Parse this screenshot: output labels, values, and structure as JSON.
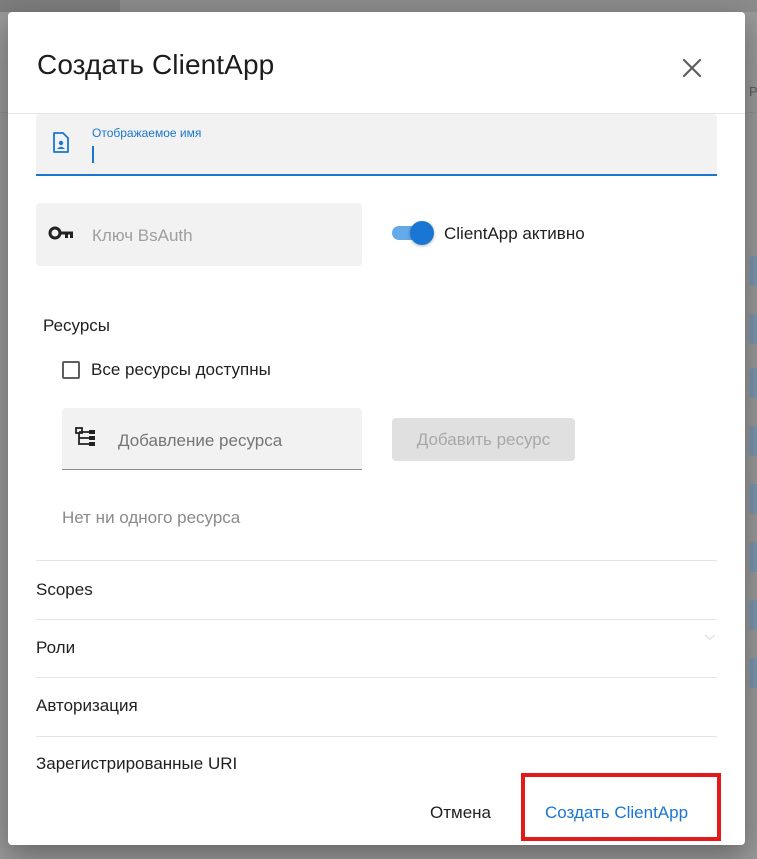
{
  "dialog": {
    "title": "Создать ClientApp",
    "close_icon": "close-icon"
  },
  "fields": {
    "display_name_label": "Отображаемое имя",
    "display_name_value": "",
    "display_name_icon": "contact-card-icon",
    "bsauth_key_placeholder": "Ключ BsAuth",
    "bsauth_key_icon": "key-icon"
  },
  "toggle": {
    "label": "ClientApp активно",
    "checked": true
  },
  "resources": {
    "section_title": "Ресурсы",
    "all_available_label": "Все ресурсы доступны",
    "all_available_checked": false,
    "add_placeholder": "Добавление ресурса",
    "add_icon": "tree-structure-icon",
    "add_button_label": "Добавить ресурс",
    "empty_text": "Нет ни одного ресурса"
  },
  "sections": [
    {
      "title": "Scopes"
    },
    {
      "title": "Роли"
    },
    {
      "title": "Авторизация"
    },
    {
      "title": "Зарегистрированные URI"
    }
  ],
  "actions": {
    "cancel_label": "Отмена",
    "create_label": "Создать ClientApp"
  },
  "colors": {
    "accent": "#1976d2",
    "highlight": "#e21a1a"
  }
}
